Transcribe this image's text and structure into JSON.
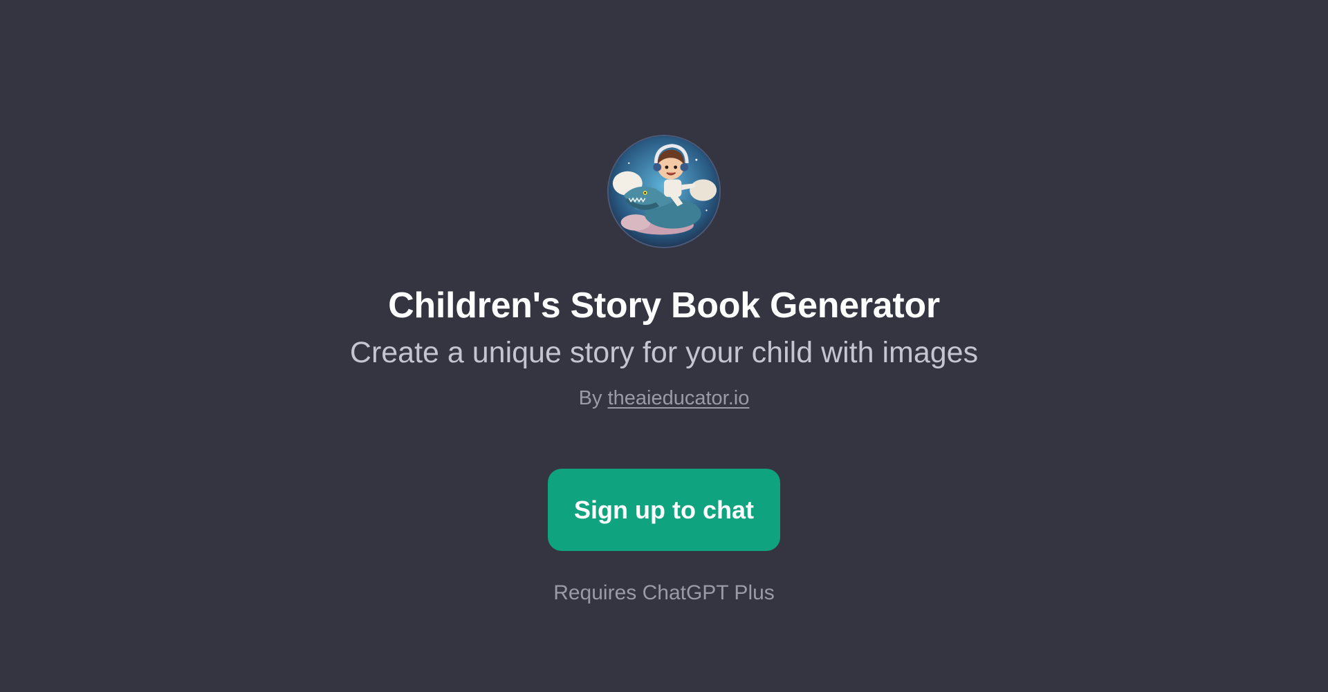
{
  "gpt": {
    "avatar_icon": "child-riding-dinosaur-avatar",
    "title": "Children's Story Book Generator",
    "description": "Create a unique story for your child with images",
    "by_prefix": "By ",
    "author_link": "theaieducator.io"
  },
  "cta": {
    "signup_label": "Sign up to chat",
    "requirement_note": "Requires ChatGPT Plus"
  },
  "colors": {
    "background": "#343541",
    "accent": "#10a37f",
    "title_text": "#ffffff",
    "subtitle_text": "#c5c5d2",
    "muted_text": "#9b9ba6"
  }
}
